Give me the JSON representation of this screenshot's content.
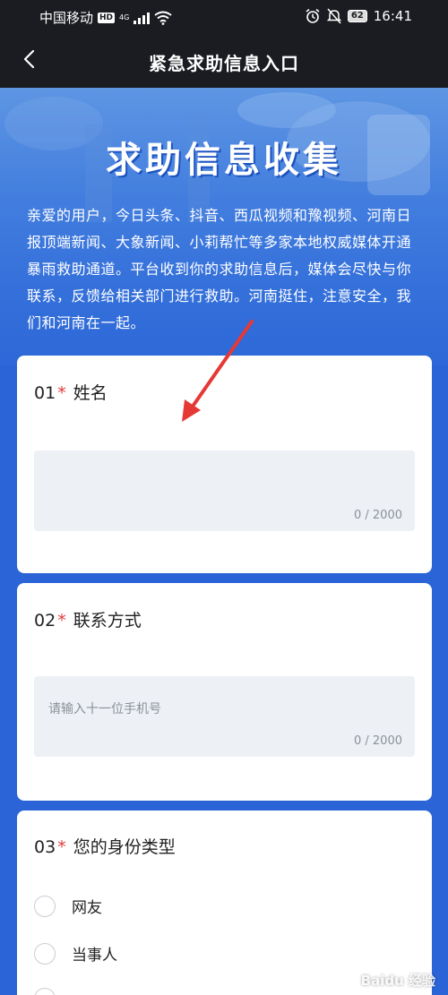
{
  "status_bar": {
    "carrier": "中国移动",
    "hd": "HD",
    "network": "4G",
    "battery": "62",
    "time": "16:41"
  },
  "nav": {
    "title": "紧急求助信息入口"
  },
  "hero": {
    "heading": "求助信息收集",
    "intro": "亲爱的用户，今日头条、抖音、西瓜视频和豫视频、河南日报顶端新闻、大象新闻、小莉帮忙等多家本地权威媒体开通暴雨救助通道。平台收到你的求助信息后，媒体会尽快与你联系，反馈给相关部门进行救助。河南挺住，注意安全，我们和河南在一起。"
  },
  "questions": [
    {
      "number": "01",
      "required": "*",
      "label": "姓名",
      "placeholder": "",
      "counter": "0 / 2000"
    },
    {
      "number": "02",
      "required": "*",
      "label": "联系方式",
      "placeholder": "请输入十一位手机号",
      "counter": "0 / 2000"
    },
    {
      "number": "03",
      "required": "*",
      "label": "您的身份类型",
      "options": [
        "网友",
        "当事人"
      ]
    }
  ],
  "watermark": "Baidu 经验",
  "colors": {
    "page_bg": "#2a64d6",
    "topbar_bg": "#1a1c21",
    "required_star": "#e23b3b",
    "input_bg": "#edf0f5",
    "arrow": "#e53935"
  }
}
